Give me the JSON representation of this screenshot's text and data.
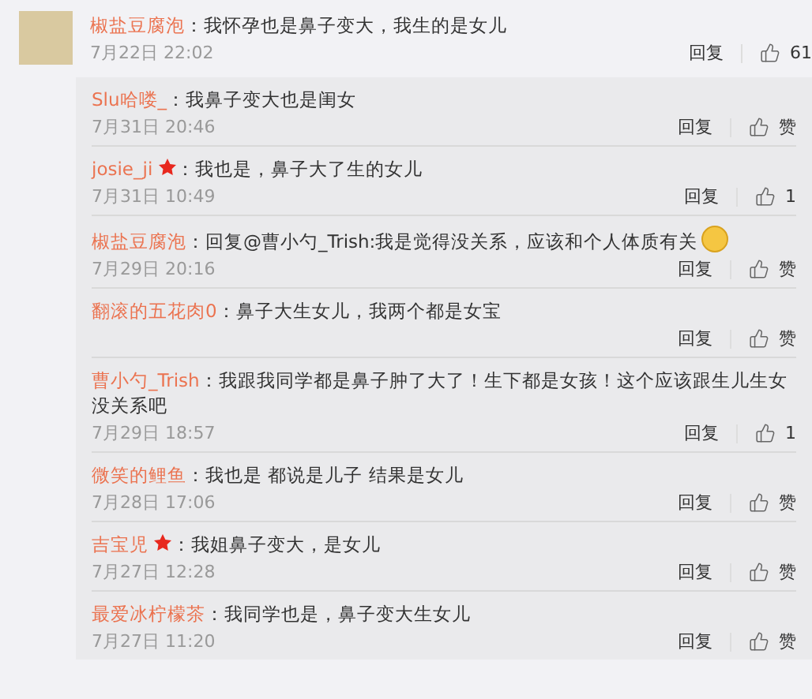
{
  "comment": {
    "author": "椒盐豆腐泡",
    "text": "：我怀孕也是鼻子变大，我生的是女儿",
    "time": "7月22日 22:02",
    "reply": "回复",
    "likes": "61"
  },
  "replies": [
    {
      "author": "Slu哈喽_",
      "vip": false,
      "text": "：我鼻子变大也是闺女",
      "emoji": false,
      "time": "7月31日 20:46",
      "reply": "回复",
      "likes": "赞"
    },
    {
      "author": "josie_ji",
      "vip": true,
      "text": "：我也是，鼻子大了生的女儿",
      "emoji": false,
      "time": "7月31日 10:49",
      "reply": "回复",
      "likes": "1"
    },
    {
      "author": "椒盐豆腐泡",
      "vip": false,
      "text": "：回复@曹小勺_Trish:我是觉得没关系，应该和个人体质有关",
      "emoji": true,
      "time": "7月29日 20:16",
      "reply": "回复",
      "likes": "赞"
    },
    {
      "author": "翻滚的五花肉0",
      "vip": false,
      "text": "：鼻子大生女儿，我两个都是女宝",
      "emoji": false,
      "reply": "回复",
      "likes": "赞"
    },
    {
      "author": "曹小勺_Trish",
      "vip": false,
      "text": "：我跟我同学都是鼻子肿了大了！生下都是女孩！这个应该跟生儿生女没关系吧",
      "emoji": false,
      "time": "7月29日 18:57",
      "reply": "回复",
      "likes": "1"
    },
    {
      "author": "微笑的鲤鱼",
      "vip": false,
      "text": "：我也是 都说是儿子 结果是女儿",
      "emoji": false,
      "time": "7月28日 17:06",
      "reply": "回复",
      "likes": "赞"
    },
    {
      "author": "吉宝児",
      "vip": true,
      "text": "：我姐鼻子变大，是女儿",
      "emoji": false,
      "time": "7月27日 12:28",
      "reply": "回复",
      "likes": "赞"
    },
    {
      "author": "最爱冰柠檬茶",
      "vip": false,
      "text": "：我同学也是，鼻子变大生女儿",
      "emoji": false,
      "time": "7月27日 11:20",
      "reply": "回复",
      "likes": "赞"
    }
  ]
}
